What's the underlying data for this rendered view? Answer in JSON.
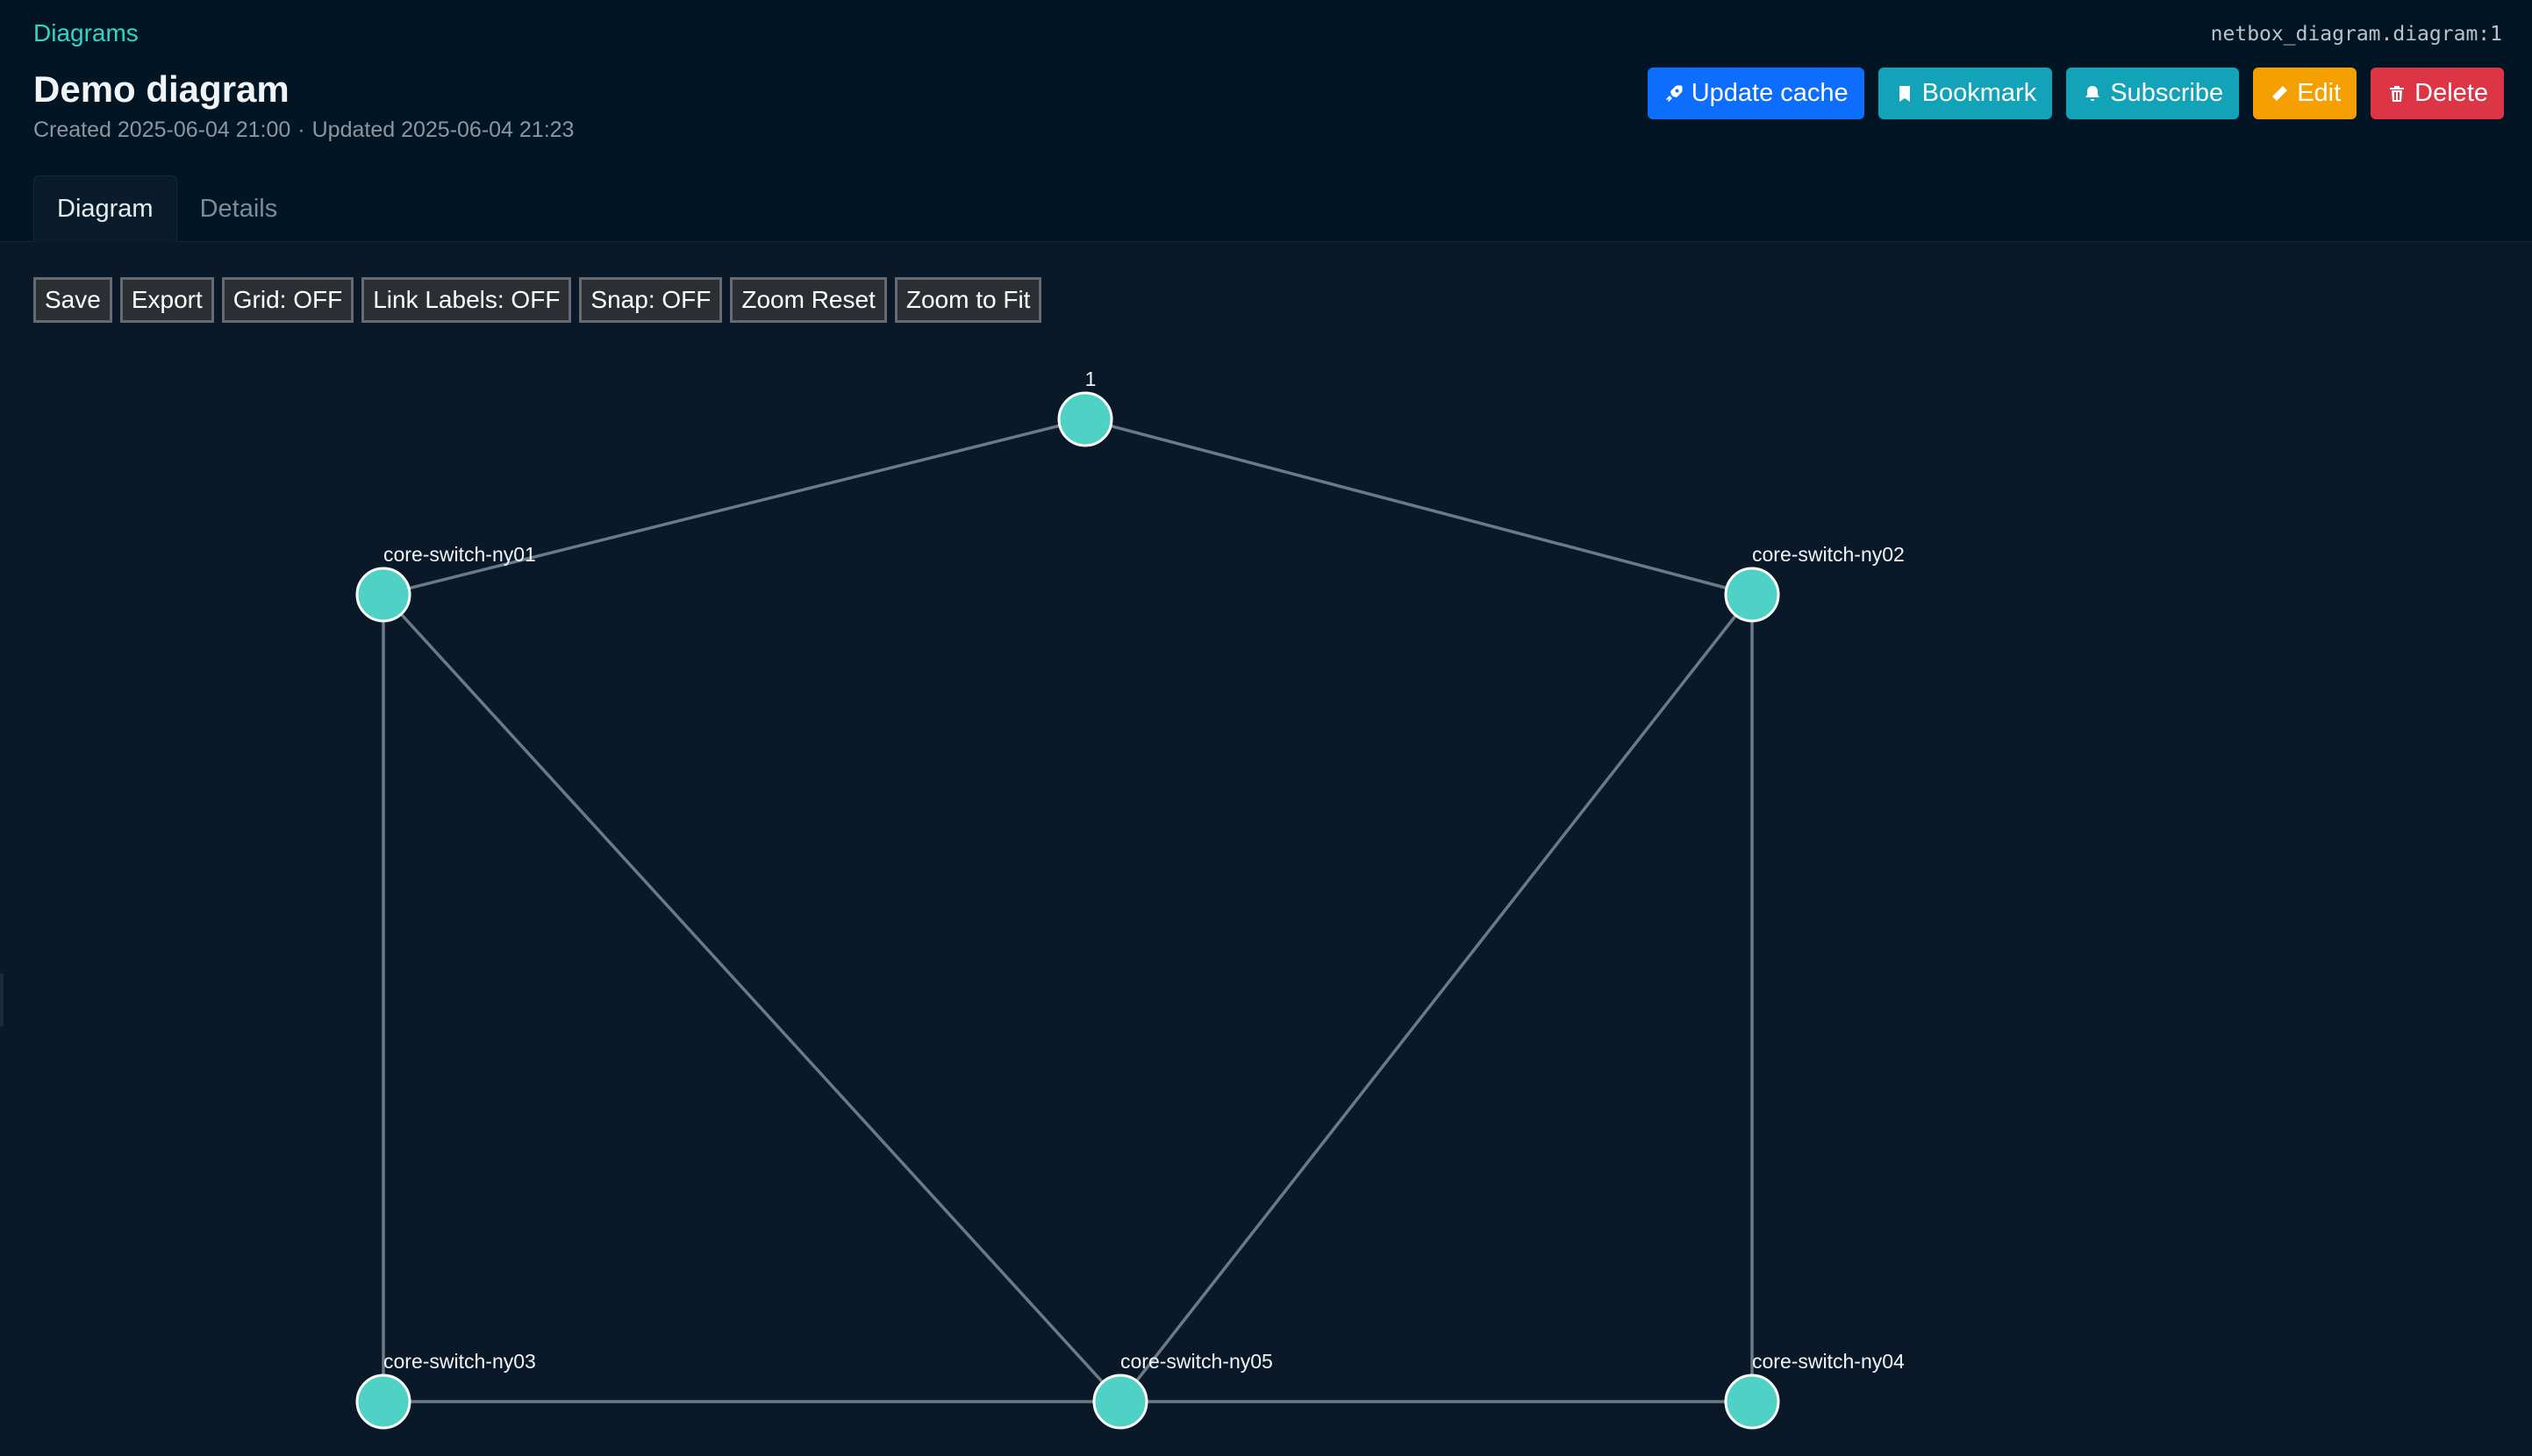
{
  "header": {
    "breadcrumb": "Diagrams",
    "object_id": "netbox_diagram.diagram:1",
    "title": "Demo diagram",
    "created": "Created 2025-06-04 21:00",
    "separator": "·",
    "updated": "Updated 2025-06-04 21:23"
  },
  "actions": {
    "update_cache": "Update cache",
    "bookmark": "Bookmark",
    "subscribe": "Subscribe",
    "edit": "Edit",
    "delete": "Delete"
  },
  "tabs": [
    {
      "label": "Diagram",
      "active": true
    },
    {
      "label": "Details",
      "active": false
    }
  ],
  "toolbar": {
    "save": "Save",
    "export": "Export",
    "grid": "Grid: OFF",
    "link_labels": "Link Labels: OFF",
    "snap": "Snap: OFF",
    "zoom_reset": "Zoom Reset",
    "zoom_fit": "Zoom to Fit"
  },
  "diagram": {
    "nodes": [
      {
        "id": "n1",
        "label": "1"
      },
      {
        "id": "ny01",
        "label": "core-switch-ny01"
      },
      {
        "id": "ny02",
        "label": "core-switch-ny02"
      },
      {
        "id": "ny03",
        "label": "core-switch-ny03"
      },
      {
        "id": "ny05",
        "label": "core-switch-ny05"
      },
      {
        "id": "ny04",
        "label": "core-switch-ny04"
      }
    ],
    "links": [
      [
        "n1",
        "ny01"
      ],
      [
        "n1",
        "ny02"
      ],
      [
        "ny01",
        "ny03"
      ],
      [
        "ny01",
        "ny05"
      ],
      [
        "ny02",
        "ny05"
      ],
      [
        "ny02",
        "ny04"
      ],
      [
        "ny03",
        "ny05"
      ],
      [
        "ny05",
        "ny04"
      ]
    ],
    "colors": {
      "node_fill": "#4fd1c5",
      "node_stroke": "#ffffff",
      "link": "#6b7a86"
    }
  }
}
